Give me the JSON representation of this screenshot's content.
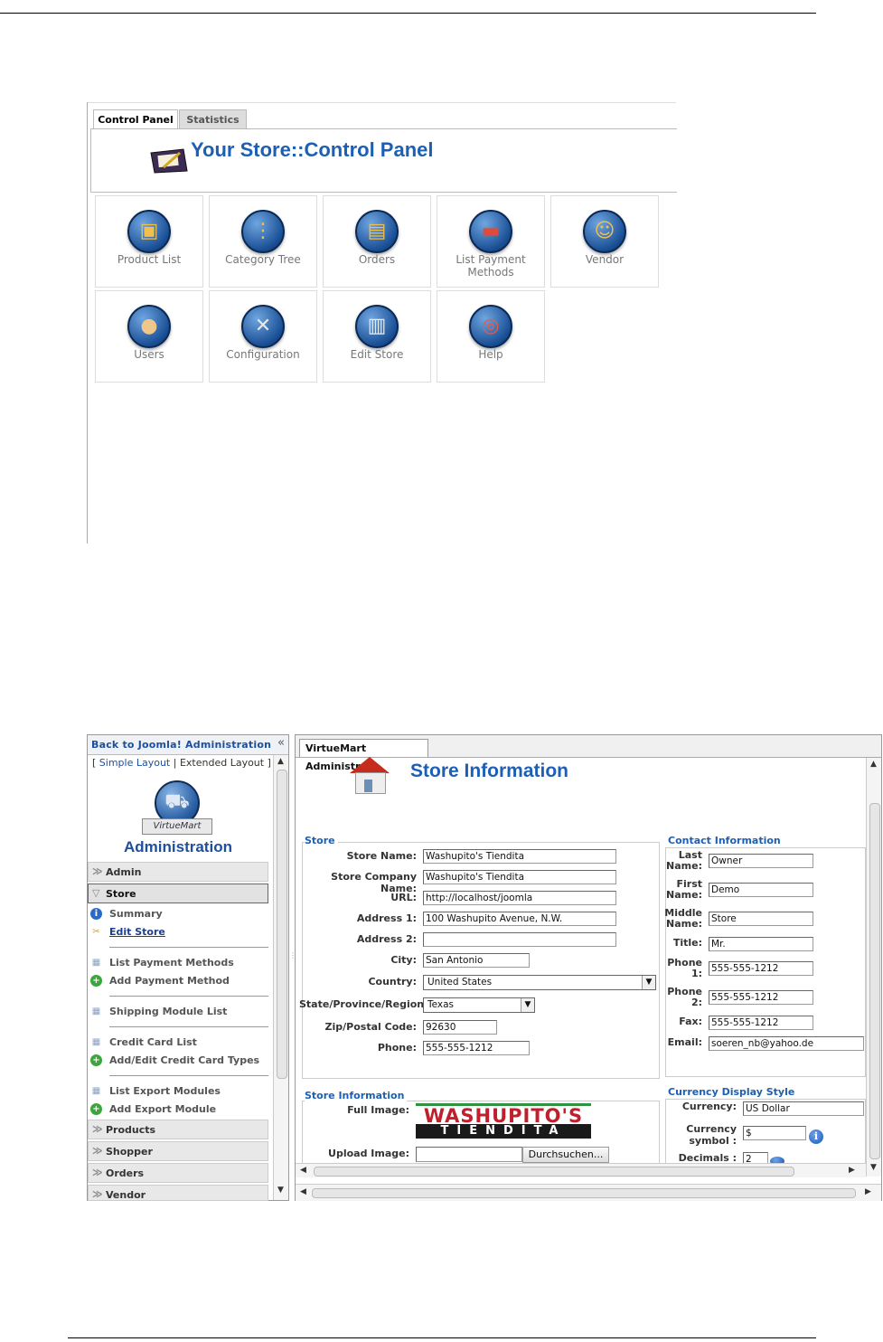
{
  "control_panel": {
    "tabs": [
      "Control Panel",
      "Statistics"
    ],
    "title": "Your Store::Control Panel",
    "tiles": [
      {
        "label": "Product List",
        "icon": "product-list-icon"
      },
      {
        "label": "Category Tree",
        "icon": "category-tree-icon"
      },
      {
        "label": "Orders",
        "icon": "orders-icon"
      },
      {
        "label": "List Payment Methods",
        "icon": "payment-methods-icon"
      },
      {
        "label": "Vendor",
        "icon": "vendor-icon"
      },
      {
        "label": "Users",
        "icon": "users-icon"
      },
      {
        "label": "Configuration",
        "icon": "configuration-icon"
      },
      {
        "label": "Edit Store",
        "icon": "edit-store-icon"
      },
      {
        "label": "Help",
        "icon": "help-icon"
      }
    ]
  },
  "admin": {
    "sidebar": {
      "back_link": "Back to Joomla! Administration",
      "collapse_glyph": "«",
      "layout_links": {
        "open": "[ ",
        "simple": "Simple Layout",
        "sep": " | ",
        "extended": "Extended Layout",
        "close": " ]"
      },
      "logo_text": "VirtueMart",
      "admin_title": "Administration",
      "sections": {
        "admin": "Admin",
        "store": "Store",
        "products": "Products",
        "shopper": "Shopper",
        "orders": "Orders",
        "vendor": "Vendor"
      },
      "store_items": {
        "summary": "Summary",
        "edit_store": "Edit Store",
        "list_payment_methods": "List Payment Methods",
        "add_payment_method": "Add Payment Method",
        "shipping_module_list": "Shipping Module List",
        "credit_card_list": "Credit Card List",
        "add_edit_credit_card_types": "Add/Edit Credit Card Types",
        "list_export_modules": "List Export Modules",
        "add_export_module": "Add Export Module"
      }
    },
    "main": {
      "tab": "VirtueMart Administrat",
      "title": "Store Information",
      "store_legend": "Store",
      "store_fields": {
        "store_name": {
          "label": "Store Name:",
          "value": "Washupito's Tiendita"
        },
        "company_name": {
          "label": "Store Company Name:",
          "value": "Washupito's Tiendita"
        },
        "url": {
          "label": "URL:",
          "value": "http://localhost/joomla"
        },
        "address1": {
          "label": "Address 1:",
          "value": "100 Washupito Avenue, N.W."
        },
        "address2": {
          "label": "Address 2:",
          "value": ""
        },
        "city": {
          "label": "City:",
          "value": "San Antonio"
        },
        "country": {
          "label": "Country:",
          "value": "United States"
        },
        "state": {
          "label": "State/Province/Region:",
          "value": "Texas"
        },
        "zip": {
          "label": "Zip/Postal Code:",
          "value": "92630"
        },
        "phone": {
          "label": "Phone:",
          "value": "555-555-1212"
        }
      },
      "contact_legend": "Contact Information",
      "contact_fields": {
        "last_name": {
          "label1": "Last",
          "label2": "Name:",
          "value": "Owner"
        },
        "first_name": {
          "label1": "First",
          "label2": "Name:",
          "value": "Demo"
        },
        "middle_name": {
          "label1": "Middle",
          "label2": "Name:",
          "value": "Store"
        },
        "title": {
          "label": "Title:",
          "value": "Mr."
        },
        "phone1": {
          "label1": "Phone",
          "label2": "1:",
          "value": "555-555-1212"
        },
        "phone2": {
          "label1": "Phone",
          "label2": "2:",
          "value": "555-555-1212"
        },
        "fax": {
          "label": "Fax:",
          "value": "555-555-1212"
        },
        "email": {
          "label": "Email:",
          "value": "soeren_nb@yahoo.de"
        }
      },
      "store_info_legend": "Store Information",
      "full_image_label": "Full Image:",
      "logo_top": "WASHUPITO'S",
      "logo_bottom": "TIENDITA",
      "upload_image_label": "Upload Image:",
      "browse_button": "Durchsuchen...",
      "currency_legend": "Currency Display Style",
      "currency": {
        "label": "Currency:",
        "value": "US Dollar"
      },
      "currency_symbol": {
        "label1": "Currency",
        "label2": "symbol :",
        "value": "$"
      },
      "decimals": {
        "label": "Decimals :",
        "value": "2"
      }
    }
  },
  "colors": {
    "accent_blue": "#1d5fb4",
    "link_blue": "#1d4f9c",
    "house_roof": "#c62b1e",
    "logo_red": "#c01f2b",
    "logo_green": "#2e9442"
  }
}
